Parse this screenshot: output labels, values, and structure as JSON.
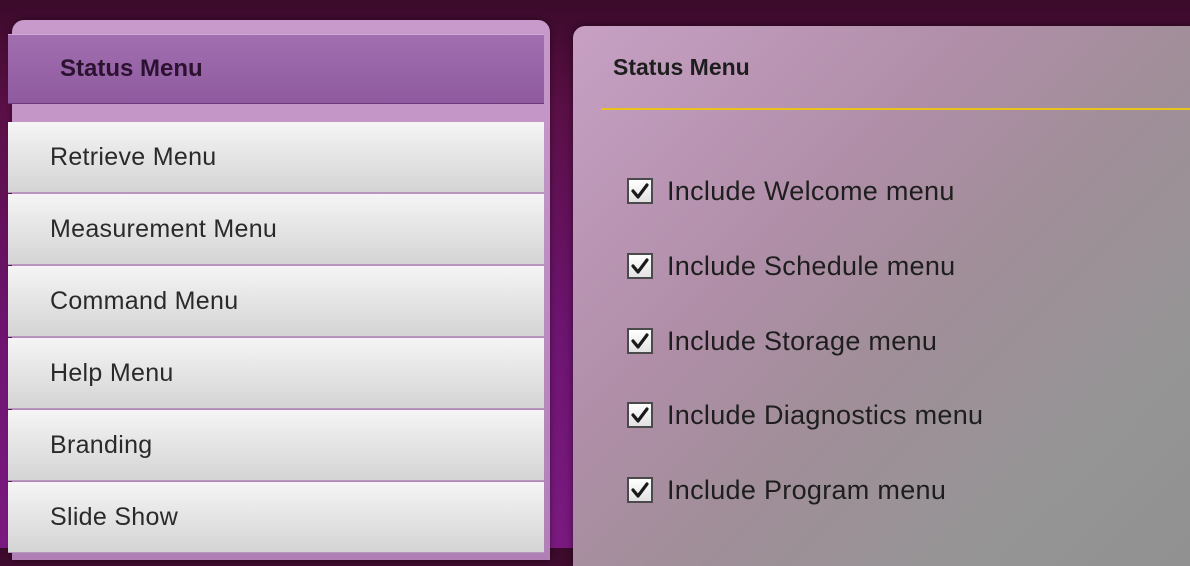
{
  "sidebar": {
    "header": "Status Menu",
    "items": [
      {
        "label": "Retrieve Menu"
      },
      {
        "label": "Measurement Menu"
      },
      {
        "label": "Command Menu"
      },
      {
        "label": "Help Menu"
      },
      {
        "label": "Branding"
      },
      {
        "label": "Slide Show"
      }
    ]
  },
  "content": {
    "title": "Status Menu",
    "options": [
      {
        "label": "Include Welcome menu",
        "checked": true
      },
      {
        "label": "Include Schedule menu",
        "checked": true
      },
      {
        "label": "Include Storage menu",
        "checked": true
      },
      {
        "label": "Include Diagnostics menu",
        "checked": true
      },
      {
        "label": "Include Program menu",
        "checked": true
      }
    ]
  },
  "colors": {
    "accent_rule": "#e8c21d",
    "header_purple": "#8f5a9f",
    "background": "#6d1470"
  }
}
